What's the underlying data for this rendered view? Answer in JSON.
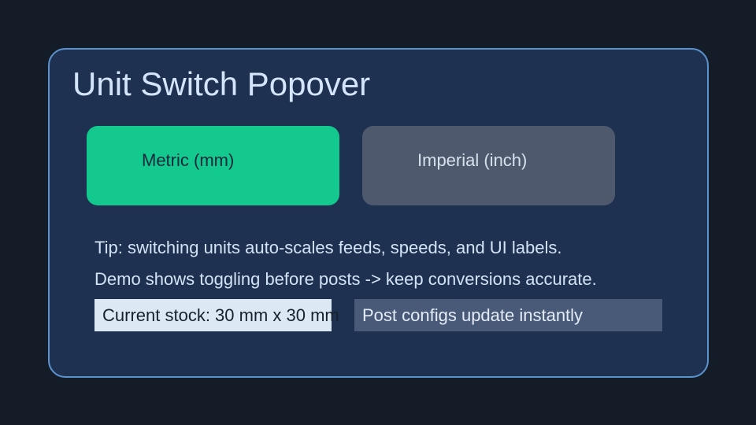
{
  "popover": {
    "title": "Unit Switch Popover",
    "units": {
      "metric_label": "Metric (mm)",
      "imperial_label": "Imperial (inch)",
      "selected": "Metric (mm)"
    },
    "tips": [
      "Tip: switching units auto-scales feeds, speeds, and UI labels.",
      "Demo shows toggling before posts -> keep conversions accurate."
    ],
    "stock_chip": "Current stock: 30 mm x 30 mm",
    "post_chip": "Post configs update instantly"
  },
  "colors": {
    "background": "#141c27",
    "panel": "#1f3150",
    "panel_border": "#5b93cf",
    "metric_active": "#14c98e",
    "imperial_inactive": "#4e596d",
    "stock_chip": "#dde8f5",
    "post_chip": "#485a78"
  }
}
